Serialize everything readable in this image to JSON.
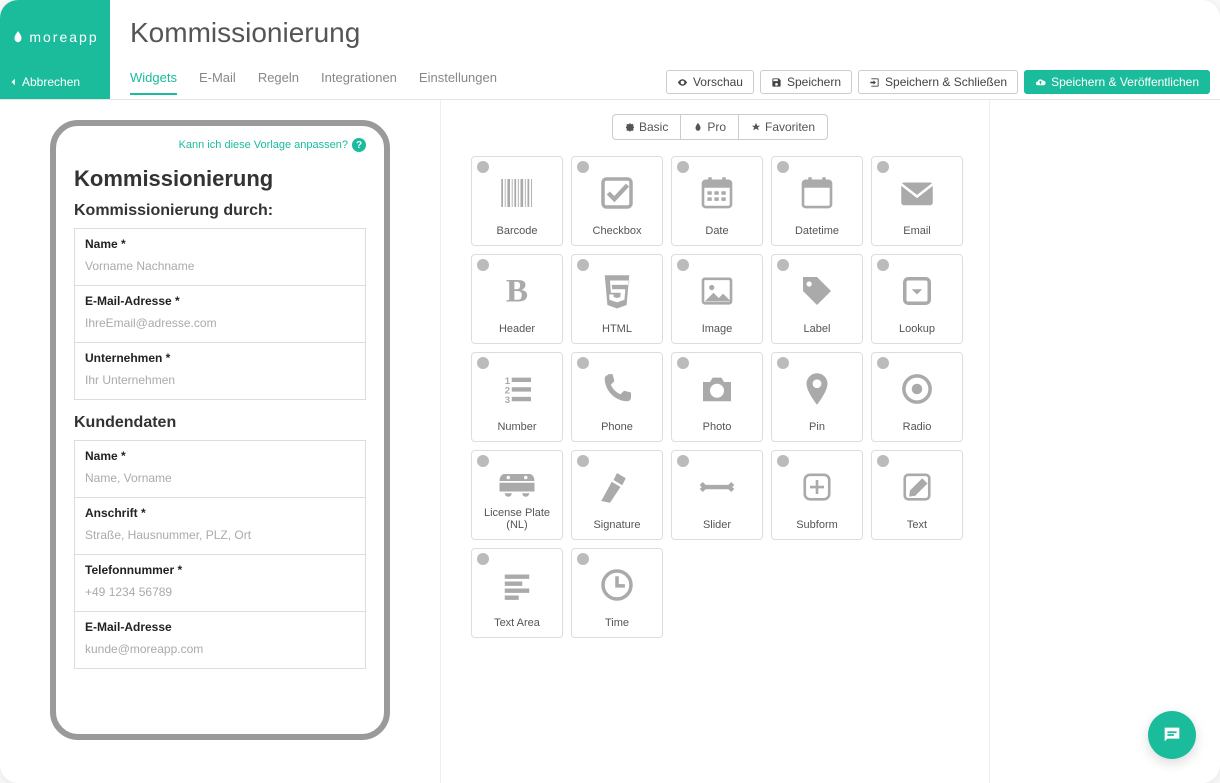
{
  "brand": {
    "name": "moreapp",
    "cancel": "Abbrechen"
  },
  "page_title": "Kommissionierung",
  "tabs": [
    {
      "label": "Widgets",
      "active": true
    },
    {
      "label": "E-Mail",
      "active": false
    },
    {
      "label": "Regeln",
      "active": false
    },
    {
      "label": "Integrationen",
      "active": false
    },
    {
      "label": "Einstellungen",
      "active": false
    }
  ],
  "actions": {
    "preview": "Vorschau",
    "save": "Speichern",
    "save_close": "Speichern & Schließen",
    "save_publish": "Speichern & Veröffentlichen"
  },
  "preview": {
    "help_link": "Kann ich diese Vorlage anpassen?",
    "form_title": "Kommissionierung",
    "section1_title": "Kommissionierung durch:",
    "section1_fields": [
      {
        "label": "Name *",
        "placeholder": "Vorname Nachname"
      },
      {
        "label": "E-Mail-Adresse *",
        "placeholder": "IhreEmail@adresse.com"
      },
      {
        "label": "Unternehmen *",
        "placeholder": "Ihr Unternehmen"
      }
    ],
    "section2_title": "Kundendaten",
    "section2_fields": [
      {
        "label": "Name *",
        "placeholder": "Name, Vorname"
      },
      {
        "label": "Anschrift *",
        "placeholder": "Straße, Hausnummer, PLZ, Ort"
      },
      {
        "label": "Telefonnummer *",
        "placeholder": "+49 1234 56789"
      },
      {
        "label": "E-Mail-Adresse",
        "placeholder": "kunde@moreapp.com"
      }
    ]
  },
  "widget_category_tabs": {
    "basic": "Basic",
    "pro": "Pro",
    "favorites": "Favoriten"
  },
  "widgets": [
    {
      "name": "barcode",
      "label": "Barcode"
    },
    {
      "name": "checkbox",
      "label": "Checkbox"
    },
    {
      "name": "date",
      "label": "Date"
    },
    {
      "name": "datetime",
      "label": "Datetime"
    },
    {
      "name": "email",
      "label": "Email"
    },
    {
      "name": "header",
      "label": "Header"
    },
    {
      "name": "html",
      "label": "HTML"
    },
    {
      "name": "image",
      "label": "Image"
    },
    {
      "name": "label",
      "label": "Label"
    },
    {
      "name": "lookup",
      "label": "Lookup"
    },
    {
      "name": "number",
      "label": "Number"
    },
    {
      "name": "phone",
      "label": "Phone"
    },
    {
      "name": "photo",
      "label": "Photo"
    },
    {
      "name": "pin",
      "label": "Pin"
    },
    {
      "name": "radio",
      "label": "Radio"
    },
    {
      "name": "license-plate",
      "label": "License Plate (NL)"
    },
    {
      "name": "signature",
      "label": "Signature"
    },
    {
      "name": "slider",
      "label": "Slider"
    },
    {
      "name": "subform",
      "label": "Subform"
    },
    {
      "name": "text",
      "label": "Text"
    },
    {
      "name": "textarea",
      "label": "Text Area"
    },
    {
      "name": "time",
      "label": "Time"
    }
  ]
}
